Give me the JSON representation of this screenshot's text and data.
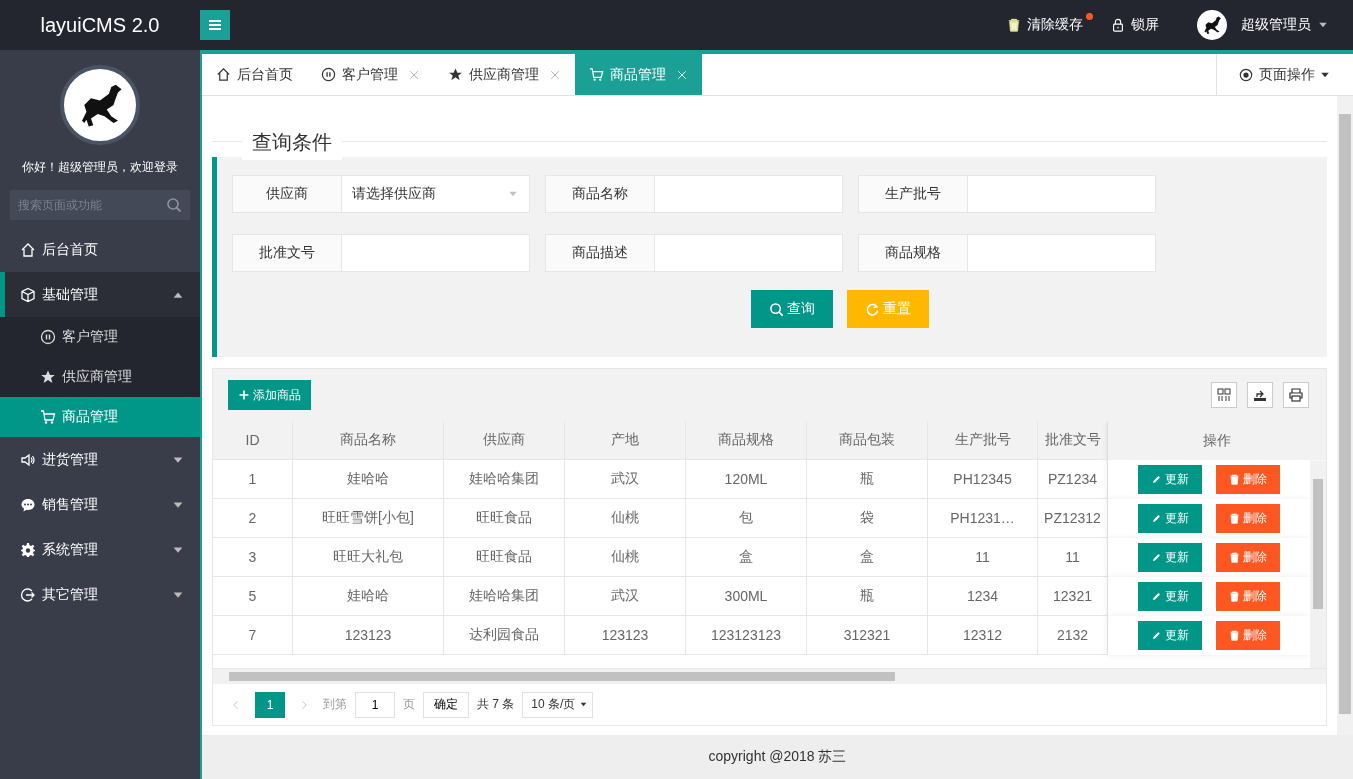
{
  "header": {
    "logo": "layuiCMS 2.0",
    "actions": [
      {
        "label": "清除缓存",
        "badge_dot": true
      },
      {
        "label": "锁屏",
        "badge_dot": false
      }
    ],
    "user": "超级管理员"
  },
  "sidebar": {
    "greeting": "你好！超级管理员，欢迎登录",
    "search": {
      "placeholder": "搜索页面或功能"
    },
    "items": [
      {
        "label": "后台首页",
        "selected": false,
        "expanded": false,
        "has_children": false
      },
      {
        "label": "基础管理",
        "selected": false,
        "expanded": true,
        "has_children": true,
        "children": [
          {
            "label": "客户管理",
            "selected": false
          },
          {
            "label": "供应商管理",
            "selected": false
          },
          {
            "label": "商品管理",
            "selected": true
          }
        ]
      },
      {
        "label": "进货管理",
        "selected": false,
        "expanded": false,
        "has_children": true
      },
      {
        "label": "销售管理",
        "selected": false,
        "expanded": false,
        "has_children": true
      },
      {
        "label": "系统管理",
        "selected": false,
        "expanded": false,
        "has_children": true
      },
      {
        "label": "其它管理",
        "selected": false,
        "expanded": false,
        "has_children": true
      }
    ]
  },
  "tabs": [
    {
      "label": "后台首页",
      "selected": false,
      "closable": false
    },
    {
      "label": "客户管理",
      "selected": false,
      "closable": true
    },
    {
      "label": "供应商管理",
      "selected": false,
      "closable": true
    },
    {
      "label": "商品管理",
      "selected": true,
      "closable": true
    }
  ],
  "page_operations": "页面操作",
  "query": {
    "legend": "查询条件",
    "fields": [
      {
        "label": "供应商",
        "kind": "select",
        "placeholder": "请选择供应商"
      },
      {
        "label": "商品名称",
        "kind": "text"
      },
      {
        "label": "生产批号",
        "kind": "text"
      },
      {
        "label": "批准文号",
        "kind": "text"
      },
      {
        "label": "商品描述",
        "kind": "text"
      },
      {
        "label": "商品规格",
        "kind": "text"
      }
    ],
    "buttons": [
      {
        "label": "查询",
        "kind": "search"
      },
      {
        "label": "重置",
        "kind": "reset"
      }
    ]
  },
  "table": {
    "add_button": "添加商品",
    "columns": [
      "ID",
      "商品名称",
      "供应商",
      "产地",
      "商品规格",
      "商品包装",
      "生产批号",
      "批准文号",
      "操作"
    ],
    "rows": [
      {
        "cells": [
          "1",
          "娃哈哈",
          "娃哈哈集团",
          "武汉",
          "120ML",
          "瓶",
          "PH12345",
          "PZ1234"
        ],
        "actions": [
          "更新",
          "删除"
        ]
      },
      {
        "cells": [
          "2",
          "旺旺雪饼[小包]",
          "旺旺食品",
          "仙桃",
          "包",
          "袋",
          "PH1231…",
          "PZ12312"
        ],
        "actions": [
          "更新",
          "删除"
        ]
      },
      {
        "cells": [
          "3",
          "旺旺大礼包",
          "旺旺食品",
          "仙桃",
          "盒",
          "盒",
          "11",
          "11"
        ],
        "actions": [
          "更新",
          "删除"
        ]
      },
      {
        "cells": [
          "5",
          "娃哈哈",
          "娃哈哈集团",
          "武汉",
          "300ML",
          "瓶",
          "1234",
          "12321"
        ],
        "actions": [
          "更新",
          "删除"
        ]
      },
      {
        "cells": [
          "7",
          "123123",
          "达利园食品",
          "123123",
          "123123123",
          "312321",
          "12312",
          "2132"
        ],
        "actions": [
          "更新",
          "删除"
        ]
      }
    ]
  },
  "pagination": {
    "pages": [
      {
        "label": "1",
        "selected": true
      }
    ],
    "goto_label": "到第",
    "goto_value": "1",
    "page_unit": "页",
    "confirm": "确定",
    "total": "共 7 条",
    "page_size": "10 条/页"
  },
  "footer": "copyright @2018 苏三"
}
